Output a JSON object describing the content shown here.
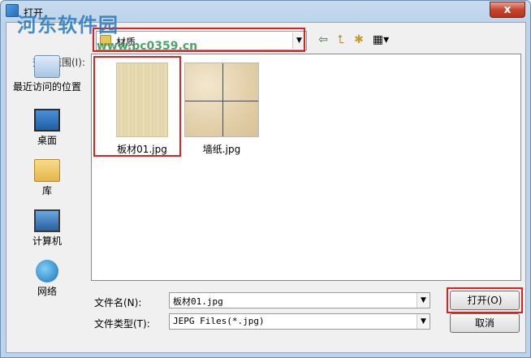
{
  "window": {
    "title": "打开",
    "close_glyph": "x"
  },
  "watermark": {
    "text": "河东软件园",
    "url": "www.pc0359.cn"
  },
  "lookin": {
    "label": "查找范围(I):",
    "value": "材质"
  },
  "places": [
    {
      "label": "最近访问的位置",
      "icon": "recent-places-icon"
    },
    {
      "label": "桌面",
      "icon": "desktop-icon"
    },
    {
      "label": "库",
      "icon": "library-icon"
    },
    {
      "label": "计算机",
      "icon": "computer-icon"
    },
    {
      "label": "网络",
      "icon": "network-icon"
    }
  ],
  "files": [
    {
      "name": "板材01.jpg",
      "selected": true
    },
    {
      "name": "墙纸.jpg",
      "selected": false
    }
  ],
  "filename": {
    "label": "文件名(N):",
    "value": "板材01.jpg"
  },
  "filetype": {
    "label": "文件类型(T):",
    "value": "JEPG Files(*.jpg)"
  },
  "buttons": {
    "open": "打开(O)",
    "cancel": "取消"
  },
  "colors": {
    "highlight": "#e02020",
    "title_bg": "#bcd3ea"
  }
}
